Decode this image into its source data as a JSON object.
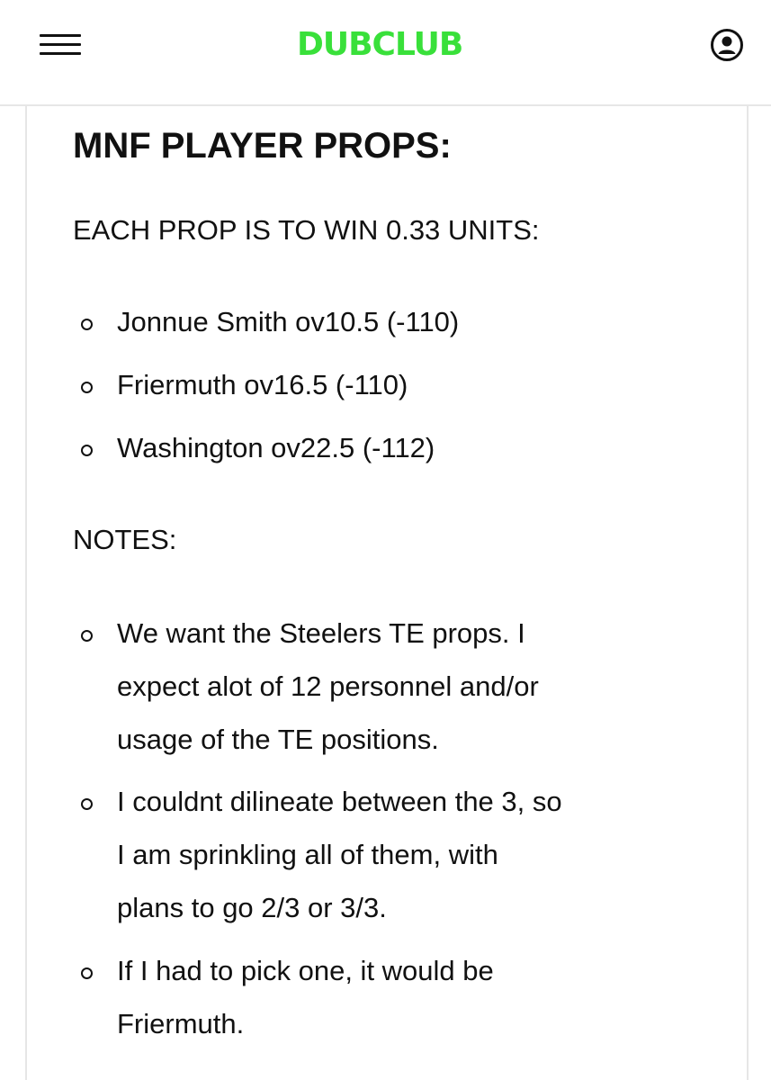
{
  "header": {
    "menu_icon": "hamburger-menu-icon",
    "logo_text": "DUBCLUB",
    "account_icon": "user-account-icon"
  },
  "post": {
    "title": "MNF PLAYER PROPS:",
    "subhead": "EACH PROP IS TO WIN 0.33 UNITS:",
    "props": [
      "Jonnue Smith ov10.5 (-110)",
      "Friermuth ov16.5 (-110)",
      "Washington ov22.5 (-112)"
    ],
    "notes_label": "NOTES:",
    "notes": [
      {
        "lines": [
          "We want the Steelers TE props. I",
          "expect alot of 12 personnel and/or",
          "usage of the TE positions."
        ]
      },
      {
        "lines": [
          "I couldnt dilineate between the 3, so",
          "I am sprinkling all of them, with",
          "plans to go 2/3 or 3/3."
        ]
      },
      {
        "lines": [
          "If I had to pick one, it would be",
          "Friermuth."
        ]
      }
    ]
  },
  "colors": {
    "brand_green": "#39e03a",
    "text": "#111111",
    "divider": "#e6e6e6"
  }
}
